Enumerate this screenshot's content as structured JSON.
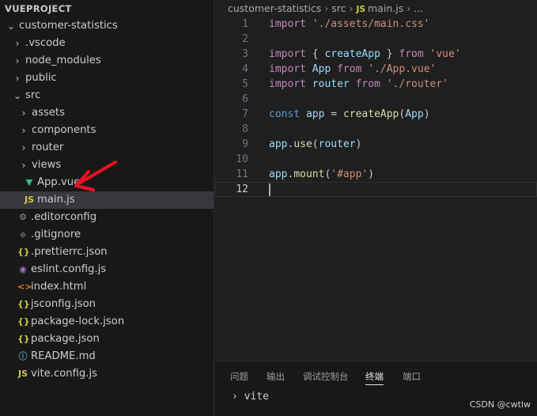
{
  "explorer": {
    "title": "VUEPROJECT",
    "items": [
      {
        "label": "customer-statistics",
        "twisty": "⌄",
        "icon": "",
        "iconColor": ""
      },
      {
        "label": ".vscode",
        "twisty": "›",
        "icon": "",
        "iconColor": ""
      },
      {
        "label": "node_modules",
        "twisty": "›",
        "icon": "",
        "iconColor": ""
      },
      {
        "label": "public",
        "twisty": "›",
        "icon": "",
        "iconColor": ""
      },
      {
        "label": "src",
        "twisty": "⌄",
        "icon": "",
        "iconColor": ""
      },
      {
        "label": "assets",
        "twisty": "›",
        "icon": "",
        "iconColor": ""
      },
      {
        "label": "components",
        "twisty": "›",
        "icon": "",
        "iconColor": ""
      },
      {
        "label": "router",
        "twisty": "›",
        "icon": "",
        "iconColor": ""
      },
      {
        "label": "views",
        "twisty": "›",
        "icon": "",
        "iconColor": ""
      },
      {
        "label": "App.vue",
        "twisty": "",
        "icon": "▼",
        "iconColor": "#41b883"
      },
      {
        "label": "main.js",
        "twisty": "",
        "icon": "JS",
        "iconColor": "#cbcb41"
      },
      {
        "label": ".editorconfig",
        "twisty": "",
        "icon": "⚙",
        "iconColor": "#8a9ba8"
      },
      {
        "label": ".gitignore",
        "twisty": "",
        "icon": "◆",
        "iconColor": "#41535b"
      },
      {
        "label": ".prettierrc.json",
        "twisty": "",
        "icon": "{}",
        "iconColor": "#cbcb41"
      },
      {
        "label": "eslint.config.js",
        "twisty": "",
        "icon": "◉",
        "iconColor": "#a074c4"
      },
      {
        "label": "index.html",
        "twisty": "",
        "icon": "<>",
        "iconColor": "#e37933"
      },
      {
        "label": "jsconfig.json",
        "twisty": "",
        "icon": "{}",
        "iconColor": "#cbcb41"
      },
      {
        "label": "package-lock.json",
        "twisty": "",
        "icon": "{}",
        "iconColor": "#cbcb41"
      },
      {
        "label": "package.json",
        "twisty": "",
        "icon": "{}",
        "iconColor": "#cbcb41"
      },
      {
        "label": "README.md",
        "twisty": "",
        "icon": "ⓘ",
        "iconColor": "#519aba"
      },
      {
        "label": "vite.config.js",
        "twisty": "",
        "icon": "JS",
        "iconColor": "#cbcb41"
      }
    ]
  },
  "breadcrumb": {
    "folder1": "customer-statistics",
    "folder2": "src",
    "file_icon": "JS",
    "file": "main.js",
    "more": "..."
  },
  "editor": {
    "lines": [
      {
        "num": "1",
        "tokens": [
          {
            "t": "import",
            "c": "kw"
          },
          {
            "t": " "
          },
          {
            "t": "'./assets/main.css'",
            "c": "str"
          }
        ]
      },
      {
        "num": "2",
        "tokens": []
      },
      {
        "num": "3",
        "tokens": [
          {
            "t": "import",
            "c": "kw"
          },
          {
            "t": " { "
          },
          {
            "t": "createApp",
            "c": "vr"
          },
          {
            "t": " } "
          },
          {
            "t": "from",
            "c": "kw"
          },
          {
            "t": " "
          },
          {
            "t": "'vue'",
            "c": "str"
          }
        ]
      },
      {
        "num": "4",
        "tokens": [
          {
            "t": "import",
            "c": "kw"
          },
          {
            "t": " "
          },
          {
            "t": "App",
            "c": "vr"
          },
          {
            "t": " "
          },
          {
            "t": "from",
            "c": "kw"
          },
          {
            "t": " "
          },
          {
            "t": "'./App.vue'",
            "c": "str"
          }
        ]
      },
      {
        "num": "5",
        "tokens": [
          {
            "t": "import",
            "c": "kw"
          },
          {
            "t": " "
          },
          {
            "t": "router",
            "c": "vr"
          },
          {
            "t": " "
          },
          {
            "t": "from",
            "c": "kw"
          },
          {
            "t": " "
          },
          {
            "t": "'./router'",
            "c": "str"
          }
        ]
      },
      {
        "num": "6",
        "tokens": []
      },
      {
        "num": "7",
        "tokens": [
          {
            "t": "const",
            "c": "ct"
          },
          {
            "t": " "
          },
          {
            "t": "app",
            "c": "vr"
          },
          {
            "t": " = "
          },
          {
            "t": "createApp",
            "c": "fn"
          },
          {
            "t": "("
          },
          {
            "t": "App",
            "c": "vr"
          },
          {
            "t": ")"
          }
        ]
      },
      {
        "num": "8",
        "tokens": []
      },
      {
        "num": "9",
        "tokens": [
          {
            "t": "app",
            "c": "vr"
          },
          {
            "t": "."
          },
          {
            "t": "use",
            "c": "fn"
          },
          {
            "t": "("
          },
          {
            "t": "router",
            "c": "vr"
          },
          {
            "t": ")"
          }
        ]
      },
      {
        "num": "10",
        "tokens": []
      },
      {
        "num": "11",
        "tokens": [
          {
            "t": "app",
            "c": "vr"
          },
          {
            "t": "."
          },
          {
            "t": "mount",
            "c": "fn"
          },
          {
            "t": "("
          },
          {
            "t": "'#app'",
            "c": "str"
          },
          {
            "t": ")"
          }
        ]
      },
      {
        "num": "12",
        "tokens": []
      }
    ]
  },
  "panel": {
    "tabs": [
      "问题",
      "输出",
      "调试控制台",
      "终端",
      "端口"
    ],
    "active_tab": "终端",
    "prompt_symbol": "›",
    "prompt_text": "vite"
  },
  "watermark": "CSDN @cwtlw",
  "colors": {
    "sidebar_bg": "#181818",
    "editor_bg": "#1f1f1f",
    "keyword": "#c586c0",
    "string": "#ce9178",
    "function": "#dcdcaa",
    "variable": "#9cdcfe",
    "const": "#569cd6",
    "annotation_arrow": "#e81123"
  }
}
